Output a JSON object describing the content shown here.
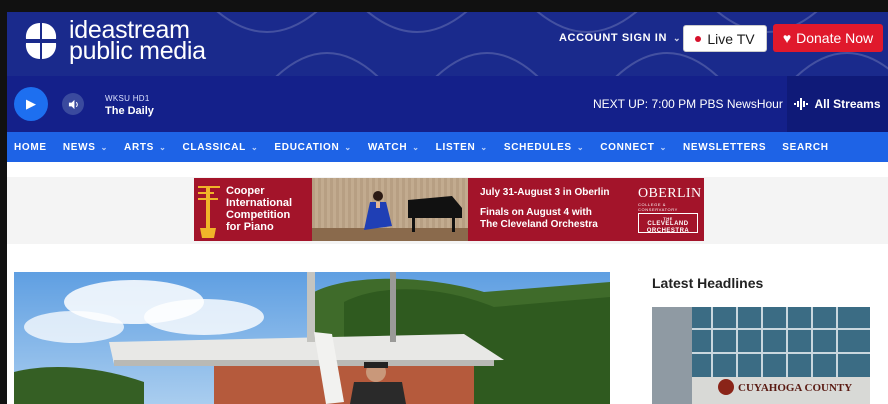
{
  "header": {
    "logo_line1": "ideastream",
    "logo_line2": "public media",
    "account_label": "ACCOUNT SIGN IN",
    "live_tv_label": "Live TV",
    "donate_label": "Donate Now"
  },
  "player": {
    "station": "WKSU HD1",
    "program": "The Daily",
    "next_up": "NEXT UP: 7:00 PM PBS NewsHour",
    "streams_label": "All Streams"
  },
  "nav": {
    "items": [
      {
        "label": "HOME",
        "dropdown": false
      },
      {
        "label": "NEWS",
        "dropdown": true
      },
      {
        "label": "ARTS",
        "dropdown": true
      },
      {
        "label": "CLASSICAL",
        "dropdown": true
      },
      {
        "label": "EDUCATION",
        "dropdown": true
      },
      {
        "label": "WATCH",
        "dropdown": true
      },
      {
        "label": "LISTEN",
        "dropdown": true
      },
      {
        "label": "SCHEDULES",
        "dropdown": true
      },
      {
        "label": "CONNECT",
        "dropdown": true
      },
      {
        "label": "NEWSLETTERS",
        "dropdown": false
      },
      {
        "label": "SEARCH",
        "dropdown": false
      }
    ]
  },
  "ad": {
    "title_line1": "Cooper",
    "title_line2": "International",
    "title_line3": "Competition",
    "title_line4": "for Piano",
    "dates": "July 31-August 3 in Oberlin",
    "finals_line1": "Finals on August 4 with",
    "finals_line2": "The Cleveland Orchestra",
    "oberlin": "OBERLIN",
    "oberlin_sub": "COLLEGE & CONSERVATORY",
    "cleveland_line1": "THE",
    "cleveland_line2": "CLEVELAND",
    "cleveland_line3": "ORCHESTRA"
  },
  "sidebar": {
    "heading": "Latest Headlines",
    "image_sign": "CUYAHOGA COUNTY"
  },
  "colors": {
    "header_bg": "#1a2a8c",
    "player_bg": "#14208a",
    "nav_bg": "#1e63e6",
    "donate": "#e0192c",
    "ad_red": "#a3142a"
  }
}
